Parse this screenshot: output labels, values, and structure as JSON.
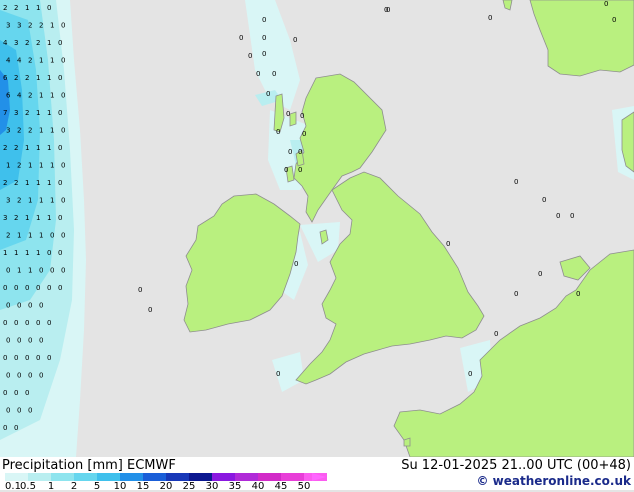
{
  "legend": {
    "title": "Precipitation [mm]",
    "model": "ECMWF",
    "ticks": [
      "0.1",
      "0.5",
      "1",
      "2",
      "5",
      "10",
      "15",
      "20",
      "25",
      "30",
      "35",
      "40",
      "45",
      "50"
    ],
    "colors": [
      "#d9f6f6",
      "#b9eef0",
      "#8ee4ee",
      "#66d6ee",
      "#3fc0ec",
      "#2290e8",
      "#1a5ed8",
      "#1838b8",
      "#0c1890",
      "#8a18e0",
      "#b02ad8",
      "#d22ac8",
      "#e83ed8",
      "#fb5cf0"
    ]
  },
  "datetime": "Su 12-01-2025 21..00 UTC (00+48)",
  "credit": "© weatheronline.co.uk",
  "colors": {
    "sea": "#e4e4e4",
    "land": "#b9f07f",
    "coast": "#8e8e8e"
  },
  "west_values": [
    [
      "2",
      "2",
      "1",
      "1",
      "0"
    ],
    [
      "3",
      "3",
      "2",
      "2",
      "1",
      "0"
    ],
    [
      "4",
      "3",
      "2",
      "2",
      "1",
      "0"
    ],
    [
      "4",
      "4",
      "2",
      "1",
      "1",
      "0"
    ],
    [
      "6",
      "2",
      "2",
      "1",
      "1",
      "0"
    ],
    [
      "6",
      "4",
      "2",
      "1",
      "1",
      "0"
    ],
    [
      "7",
      "3",
      "2",
      "1",
      "1",
      "0"
    ],
    [
      "3",
      "2",
      "2",
      "1",
      "1",
      "0"
    ],
    [
      "2",
      "2",
      "1",
      "1",
      "1",
      "0"
    ],
    [
      "1",
      "2",
      "1",
      "1",
      "1",
      "0"
    ],
    [
      "2",
      "2",
      "1",
      "1",
      "1",
      "0"
    ],
    [
      "3",
      "2",
      "1",
      "1",
      "1",
      "0"
    ],
    [
      "3",
      "2",
      "1",
      "1",
      "1",
      "0"
    ],
    [
      "2",
      "1",
      "1",
      "1",
      "0",
      "0"
    ],
    [
      "1",
      "1",
      "1",
      "1",
      "0",
      "0"
    ],
    [
      "0",
      "1",
      "1",
      "0",
      "0",
      "0"
    ],
    [
      "0",
      "0",
      "0",
      "0",
      "0",
      "0"
    ],
    [
      "0",
      "0",
      "0",
      "0"
    ],
    [
      "0",
      "0",
      "0",
      "0",
      "0"
    ],
    [
      "0",
      "0",
      "0",
      "0"
    ],
    [
      "0",
      "0",
      "0",
      "0",
      "0"
    ],
    [
      "0",
      "0",
      "0",
      "0"
    ],
    [
      "0",
      "0",
      "0"
    ],
    [
      "0",
      "0",
      "0"
    ],
    [
      "0",
      "0"
    ]
  ],
  "scattered_values": [
    "0",
    "0",
    "0",
    "0",
    "0",
    "0",
    "0",
    "0",
    "0",
    "0",
    "0",
    "0",
    "0",
    "0",
    "0",
    "0",
    "0",
    "0",
    "0",
    "0",
    "0",
    "0",
    "0",
    "0",
    "0",
    "0",
    "0",
    "0",
    "0",
    "0",
    "0",
    "0",
    "0",
    "0",
    "0",
    "0"
  ]
}
